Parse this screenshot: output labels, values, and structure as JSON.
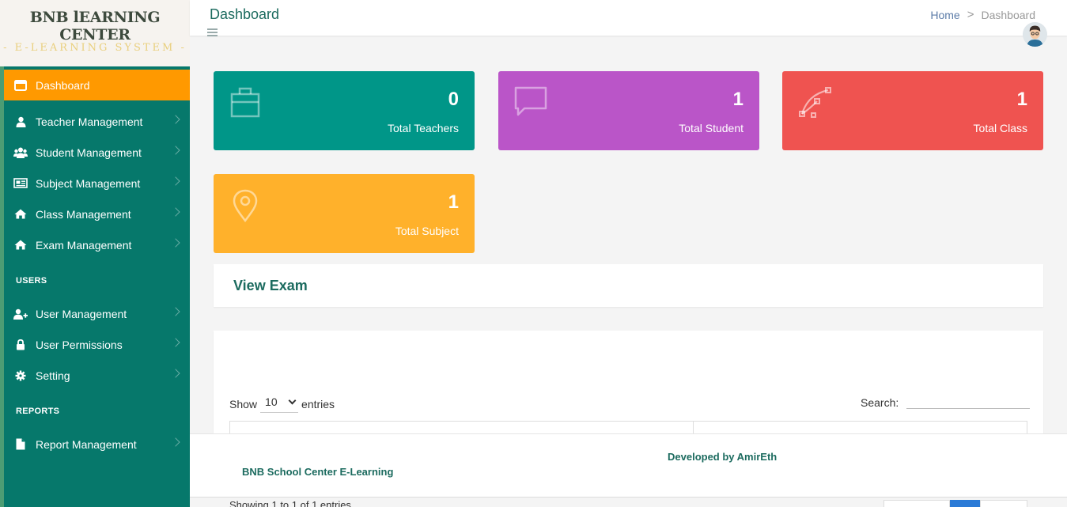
{
  "brand": {
    "title": "BNB lEARNING CENTER",
    "subtitle": "- E-LEARNING SYSTEM -"
  },
  "sidebar": {
    "items": [
      {
        "label": "Dashboard",
        "icon": "dashboard-icon",
        "active": true
      },
      {
        "label": "Teacher Management",
        "icon": "user-icon"
      },
      {
        "label": "Student Management",
        "icon": "users-icon"
      },
      {
        "label": "Subject Management",
        "icon": "newspaper-icon"
      },
      {
        "label": "Class Management",
        "icon": "home-icon"
      },
      {
        "label": "Exam Management",
        "icon": "home-icon"
      }
    ],
    "users_heading": "USERS",
    "users_items": [
      {
        "label": "User Management",
        "icon": "user-plus-icon"
      },
      {
        "label": "User Permissions",
        "icon": "lock-icon"
      },
      {
        "label": "Setting",
        "icon": "gear-icon"
      }
    ],
    "reports_heading": "REPORTS",
    "reports_items": [
      {
        "label": "Report Management",
        "icon": "file-icon"
      }
    ]
  },
  "header": {
    "title": "Dashboard",
    "breadcrumb": {
      "home": "Home",
      "separator": ">",
      "current": "Dashboard"
    }
  },
  "stats": [
    {
      "value": "0",
      "label": "Total Teachers",
      "color": "#009688",
      "icon": "briefcase-icon"
    },
    {
      "value": "1",
      "label": "Total Student",
      "color": "#ba55c8",
      "icon": "chat-bubble-icon"
    },
    {
      "value": "1",
      "label": "Total Class",
      "color": "#ef5350",
      "icon": "vector-path-icon"
    },
    {
      "value": "1",
      "label": "Total Subject",
      "color": "#ffb12b",
      "icon": "map-pin-icon"
    }
  ],
  "exam": {
    "title": "View Exam",
    "show_label": "Show",
    "entries_value": "10",
    "entries_label": "entries",
    "search_label": "Search:",
    "info": "Showing 1 to 1 of 1 entries"
  },
  "footer": {
    "developer": "Developed by AmirEth",
    "brand": "BNB School Center E-Learning"
  },
  "colors": {
    "sidebar_bg": "#06786b",
    "active_item": "#ff9900",
    "accent_text": "#1c6b5f"
  }
}
